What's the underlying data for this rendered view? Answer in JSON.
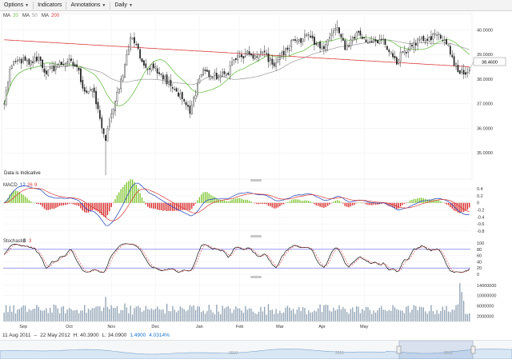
{
  "toolbar": {
    "items": [
      {
        "label": "Options"
      },
      {
        "label": "Indicators"
      },
      {
        "label": "Annotations"
      },
      {
        "label": "Daily"
      }
    ]
  },
  "legend": {
    "ma_label": "MA",
    "ma1_period": "20",
    "ma2_label": "MA",
    "ma2_period": "50",
    "ma3_label": "MA",
    "ma3_period": "200",
    "ma1_color": "#6cc04a",
    "ma2_color": "#9a9a9a",
    "ma3_color": "#d93a3a"
  },
  "indicative_note": "Data is Indicative",
  "current_price_badge": "38.4600",
  "macd": {
    "label": "MACD",
    "p1": "12",
    "p2": "26",
    "p3": "9"
  },
  "stochastic": {
    "label": "Stochastic",
    "p1": "3",
    "p2": "3"
  },
  "footer": {
    "start_date": "11 Aug 2011",
    "arrow": "–",
    "end_date": "22 May 2012",
    "high": "H: 40.3900",
    "low": "L: 34.0900",
    "change": "1.4900",
    "change_pct": "4.0314%",
    "change_color": "#1a73c9"
  },
  "navigator": {
    "labels": [
      "2010",
      "2011",
      "2012"
    ]
  },
  "chart_data": [
    {
      "type": "candlestick",
      "title": "",
      "x_tick_labels": [
        "Sep",
        "Oct",
        "Nov",
        "Dec",
        "Jan",
        "Feb",
        "Mar",
        "Apr",
        "May"
      ],
      "y_tick_labels": [
        "40.0000",
        "39.0000",
        "38.0000",
        "37.0000",
        "36.0000",
        "35.0000"
      ],
      "ylim": [
        34.0,
        40.6
      ],
      "grid": true,
      "start_price": 37.0,
      "high": 40.39,
      "low": 34.09,
      "last": 38.46,
      "close_waypoints": [
        [
          0,
          37.0
        ],
        [
          3,
          38.4
        ],
        [
          8,
          38.8
        ],
        [
          13,
          38.6
        ],
        [
          18,
          38.9
        ],
        [
          22,
          38.2
        ],
        [
          28,
          38.6
        ],
        [
          33,
          38.7
        ],
        [
          38,
          38.5
        ],
        [
          42,
          37.5
        ],
        [
          46,
          37.6
        ],
        [
          50,
          36.4
        ],
        [
          53,
          35.5
        ],
        [
          56,
          36.6
        ],
        [
          60,
          37.6
        ],
        [
          63,
          38.6
        ],
        [
          66,
          39.7
        ],
        [
          69,
          39.4
        ],
        [
          72,
          38.7
        ],
        [
          75,
          38.4
        ],
        [
          79,
          38.5
        ],
        [
          82,
          38.2
        ],
        [
          86,
          37.9
        ],
        [
          90,
          37.5
        ],
        [
          94,
          37.1
        ],
        [
          97,
          36.6
        ],
        [
          101,
          37.8
        ],
        [
          104,
          38.4
        ],
        [
          108,
          38.1
        ],
        [
          112,
          38.1
        ],
        [
          116,
          38.2
        ],
        [
          120,
          38.8
        ],
        [
          124,
          38.9
        ],
        [
          128,
          39.0
        ],
        [
          132,
          38.9
        ],
        [
          136,
          39.1
        ],
        [
          140,
          38.6
        ],
        [
          144,
          38.9
        ],
        [
          148,
          39.2
        ],
        [
          151,
          39.6
        ],
        [
          154,
          39.6
        ],
        [
          158,
          39.8
        ],
        [
          162,
          39.4
        ],
        [
          166,
          39.3
        ],
        [
          170,
          39.7
        ],
        [
          174,
          40.1
        ],
        [
          178,
          39.2
        ],
        [
          181,
          39.6
        ],
        [
          185,
          39.9
        ],
        [
          189,
          39.5
        ],
        [
          193,
          39.6
        ],
        [
          197,
          39.6
        ],
        [
          200,
          39.2
        ],
        [
          203,
          38.9
        ],
        [
          205,
          38.6
        ],
        [
          207,
          39.1
        ],
        [
          211,
          39.2
        ],
        [
          214,
          39.5
        ],
        [
          218,
          39.7
        ],
        [
          222,
          39.7
        ],
        [
          226,
          39.8
        ],
        [
          230,
          39.6
        ],
        [
          234,
          38.9
        ],
        [
          237,
          38.3
        ],
        [
          240,
          38.2
        ],
        [
          243,
          38.46
        ]
      ],
      "series": [
        {
          "name": "MA 20"
        },
        {
          "name": "MA 50"
        },
        {
          "name": "MA 200"
        }
      ]
    },
    {
      "type": "bar",
      "title": "MACD 12 26 9",
      "y_tick_labels": [
        "0.4",
        "0.2",
        "0",
        "-0.2",
        "-0.4",
        "-0.6",
        "-0.8"
      ],
      "ylim": [
        -0.85,
        0.45
      ]
    },
    {
      "type": "line",
      "title": "Stochastic 3 3",
      "y_tick_labels": [
        "100",
        "80",
        "60",
        "40",
        "20",
        "0"
      ],
      "ylim": [
        0,
        100
      ]
    },
    {
      "type": "bar",
      "title": "Volume",
      "y_tick_labels": [
        "14000000",
        "10000000",
        "6000000",
        "2000000"
      ],
      "ylim": [
        0,
        15500000
      ]
    }
  ]
}
